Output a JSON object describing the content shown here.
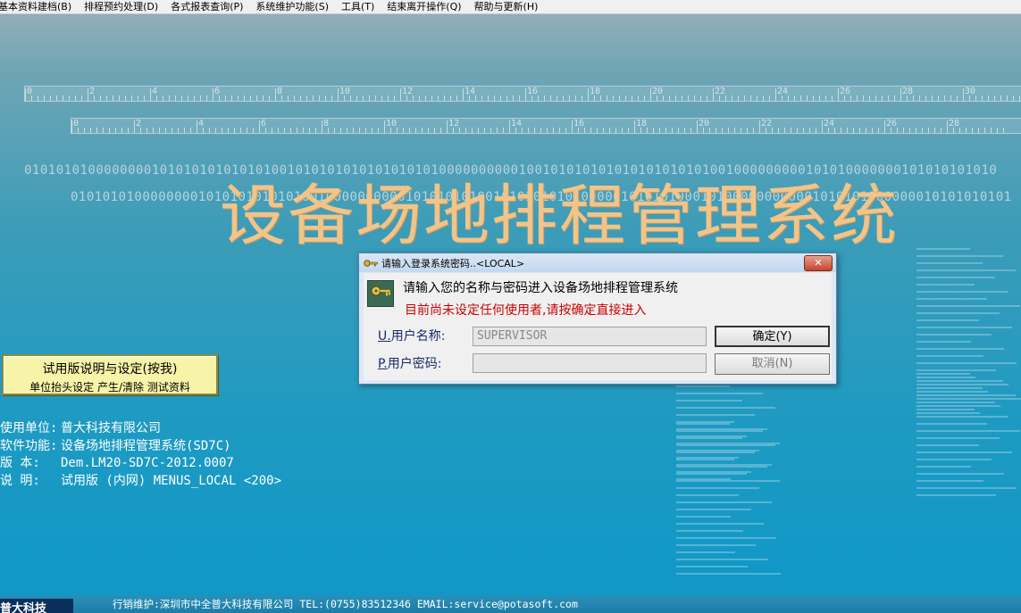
{
  "menu": [
    "基本资料建档(B)",
    "排程预约处理(D)",
    "各式报表查询(P)",
    "系统维护功能(S)",
    "工具(T)",
    "结束离开操作(Q)",
    "帮助与更新(H)"
  ],
  "ruler1_labels": [
    "0",
    "2",
    "4",
    "6",
    "8",
    "10",
    "12",
    "14",
    "16",
    "18",
    "20",
    "22",
    "24",
    "26",
    "28",
    "30"
  ],
  "ruler2_labels": [
    "0",
    "2",
    "4",
    "6",
    "8",
    "10",
    "12",
    "14",
    "16",
    "18",
    "20",
    "22",
    "24",
    "26",
    "28"
  ],
  "binary1": "01010101000000001010101010101010010101010101010101010000000000100101010101010101010101001000000000101010000000101010101010",
  "binary2": "0101010100000000101010101010100100000000001010101010010101010101000001010101000101000000000001010101000000010101010101",
  "big_title": "设备场地排程管理系统",
  "trial": {
    "line1": "试用版说明与设定(按我)",
    "line2": "单位抬头设定 产生/清除 测试资料"
  },
  "info": [
    {
      "key": "使用单位:",
      "value": "普大科技有限公司"
    },
    {
      "key": "软件功能:",
      "value": "设备场地排程管理系统(SD7C)"
    },
    {
      "key": "版    本:",
      "value": "Dem.LM20-SD7C-2012.0007"
    },
    {
      "key": "说    明:",
      "value": "试用版 (内网) MENUS_LOCAL <200>"
    }
  ],
  "footer": {
    "logo": "普大科技",
    "text": "行销维护:深圳市中全普大科技有限公司 TEL:(0755)83512346 EMAIL:service@potasoft.com"
  },
  "dialog": {
    "title": "请输入登录系统密码..<LOCAL>",
    "close": "✕",
    "message": "请输入您的名称与密码进入设备场地排程管理系统",
    "warning": "目前尚未设定任何使用者,请按确定直接进入",
    "user_label_key": "U.",
    "user_label": "用户名称:",
    "user_value": "SUPERVISOR",
    "pass_label_key": "P.",
    "pass_label": "用户密码:",
    "pass_value": "",
    "ok_label": "确定(Y)",
    "cancel_label": "取消(N)"
  }
}
